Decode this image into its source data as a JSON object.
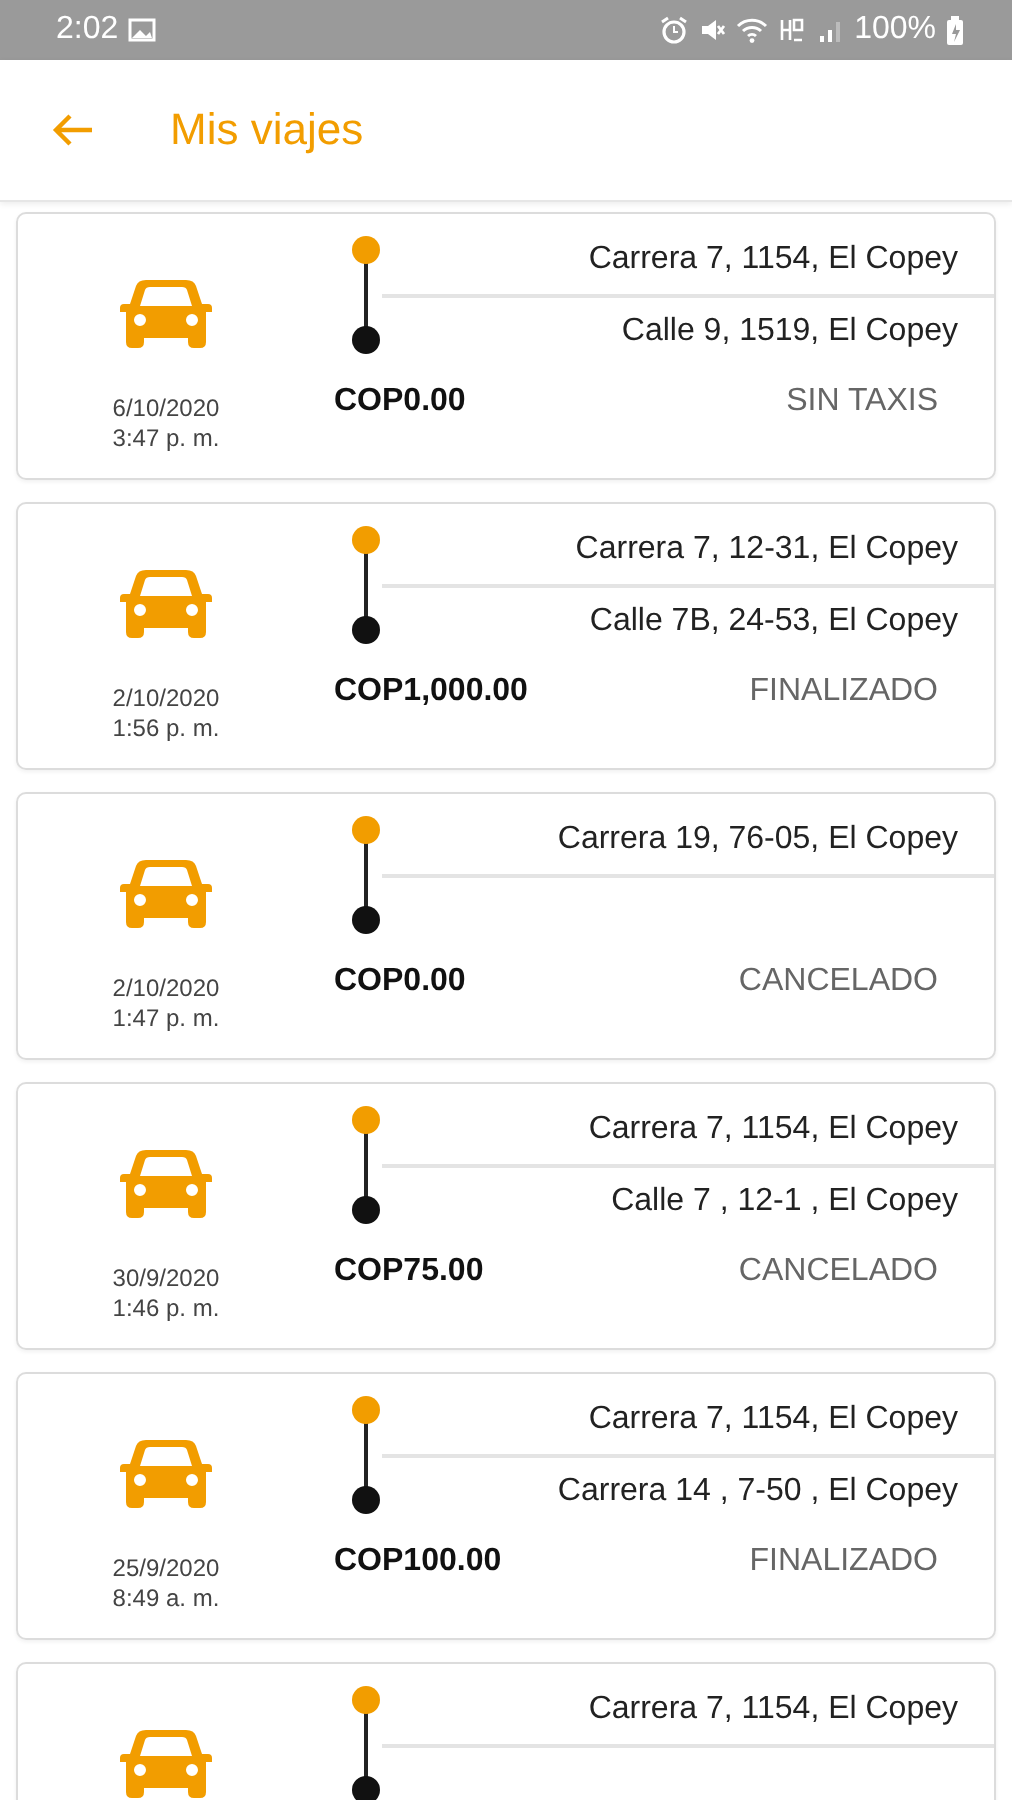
{
  "status_bar": {
    "time": "2:02",
    "battery": "100%"
  },
  "header": {
    "title": "Mis viajes"
  },
  "trips": [
    {
      "date": "6/10/2020",
      "time": "3:47 p. m.",
      "origin": "Carrera 7, 1154, El Copey",
      "destination": "Calle 9, 1519, El Copey",
      "price": "COP0.00",
      "status": "SIN TAXIS"
    },
    {
      "date": "2/10/2020",
      "time": "1:56 p. m.",
      "origin": "Carrera 7, 12-31, El Copey",
      "destination": "Calle 7B, 24-53, El Copey",
      "price": "COP1,000.00",
      "status": "FINALIZADO"
    },
    {
      "date": "2/10/2020",
      "time": "1:47 p. m.",
      "origin": "Carrera 19, 76-05, El Copey",
      "price": "COP0.00",
      "status": "CANCELADO"
    },
    {
      "date": "30/9/2020",
      "time": "1:46 p. m.",
      "origin": "Carrera 7, 1154, El Copey",
      "destination": "Calle 7 , 12-1 , El Copey",
      "price": "COP75.00",
      "status": "CANCELADO"
    },
    {
      "date": "25/9/2020",
      "time": "8:49 a. m.",
      "origin": "Carrera 7, 1154, El Copey",
      "destination": "Carrera 14 , 7-50 , El Copey",
      "price": "COP100.00",
      "status": "FINALIZADO"
    },
    {
      "origin": "Carrera 7, 1154, El Copey"
    }
  ]
}
